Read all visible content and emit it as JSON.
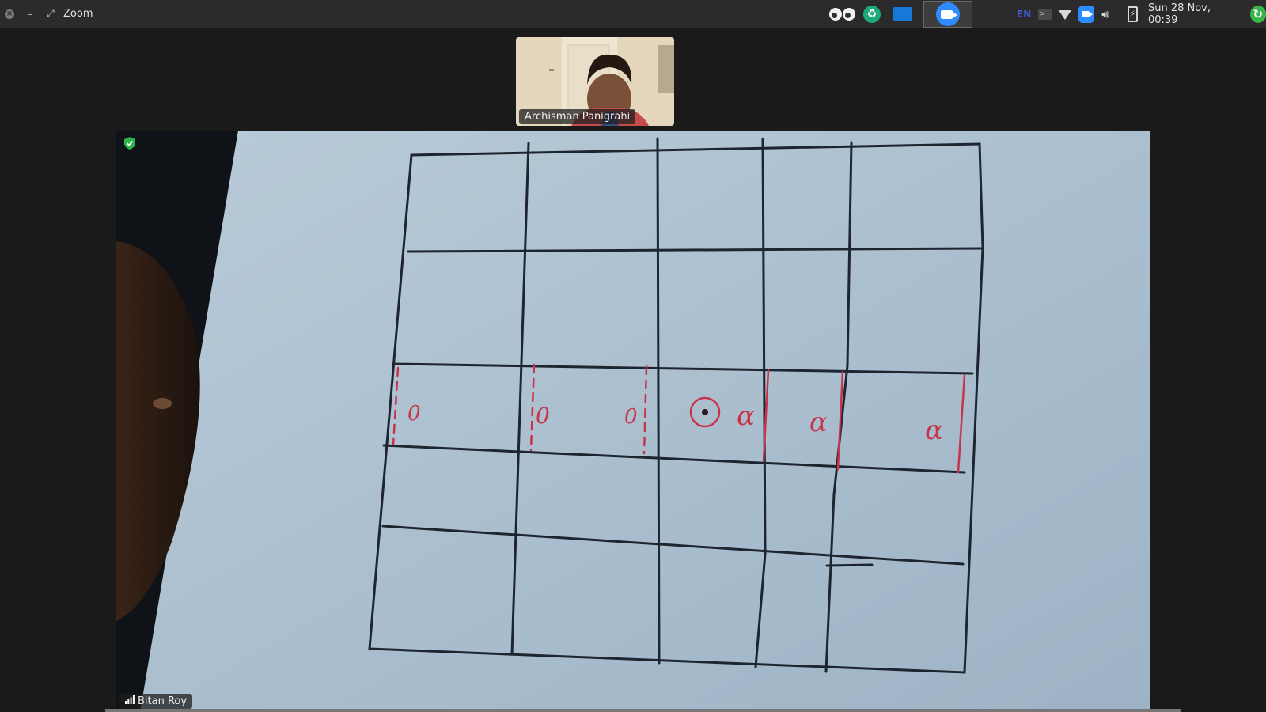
{
  "titlebar": {
    "close_glyph": "×",
    "minimize_glyph": "–",
    "restore_glyph": "⤢",
    "app_title": "Zoom"
  },
  "tray": {
    "language": "EN",
    "terminal_glyph": ">_",
    "clock": "Sun 28 Nov, 00:39",
    "icons": [
      "eyes-icon",
      "green-app-icon",
      "screen-share-icon",
      "zoom-taskbar-icon",
      "keyboard-layout-icon",
      "terminal-icon",
      "wifi-icon",
      "zoom-tray-icon",
      "volume-icon",
      "battery-icon",
      "update-icon"
    ]
  },
  "participants": {
    "thumbnail_name": "Archisman Panigrahi",
    "active_speaker_name": "Bitan Roy"
  },
  "whiteboard": {
    "marks": [
      "0",
      "0",
      "0",
      "α",
      "α",
      "α"
    ],
    "center_symbol": "⊙"
  },
  "colors": {
    "topbar": "#2b2b2b",
    "background": "#1a1a1a",
    "zoom_blue": "#2d8cff",
    "encryption_green": "#2db34a",
    "grid_ink": "#1d2530",
    "red_ink": "#c8344a"
  }
}
